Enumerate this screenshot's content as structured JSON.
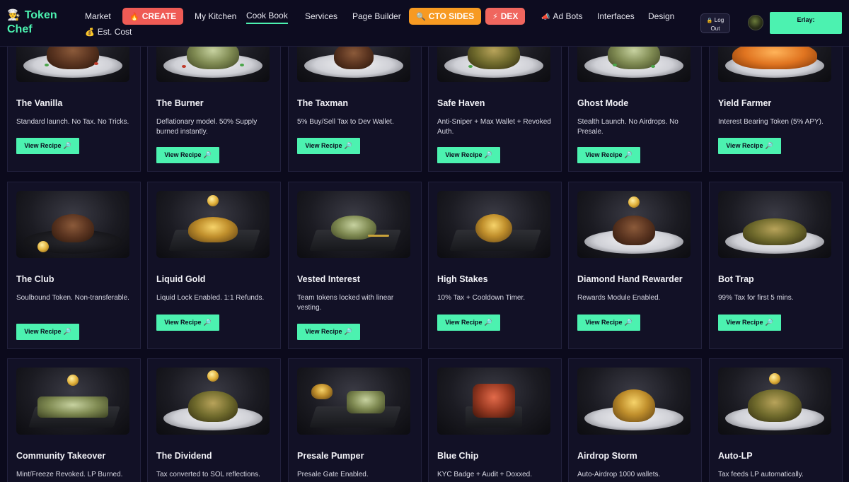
{
  "header": {
    "logo_line1": "Token",
    "logo_line2": "Chef",
    "logo_icon": "chef-icon",
    "est_cost": "Est. Cost",
    "nav": {
      "market": "Market",
      "create": "CREATE",
      "my_kitchen": "My Kitchen",
      "cook_book": "Cook Book",
      "services": "Services",
      "page_builder": "Page Builder",
      "cto_sides": "CTO SIDES",
      "dex": "DEX",
      "ad_bots": "Ad Bots",
      "interfaces": "Interfaces",
      "design": "Design"
    },
    "active_tab": "Cook Book",
    "logout_line1": "Log",
    "logout_line2": "Out",
    "user_label": "Erlay:",
    "colors": {
      "accent": "#4cf2b0",
      "create": "#ef5b55",
      "cto": "#f79a22",
      "dex": "#f0665e",
      "background": "#0b0a1c"
    }
  },
  "recipe_button_label": "View Recipe",
  "recipes": [
    {
      "title": "The Vanilla",
      "desc": "Standard launch. No Tax. No Tricks."
    },
    {
      "title": "The Burner",
      "desc": "Deflationary model. 50% Supply burned instantly."
    },
    {
      "title": "The Taxman",
      "desc": "5% Buy/Sell Tax to Dev Wallet."
    },
    {
      "title": "Safe Haven",
      "desc": "Anti-Sniper + Max Wallet + Revoked Auth."
    },
    {
      "title": "Ghost Mode",
      "desc": "Stealth Launch. No Airdrops. No Presale."
    },
    {
      "title": "Yield Farmer",
      "desc": "Interest Bearing Token (5% APY)."
    },
    {
      "title": "The Club",
      "desc": "Soulbound Token. Non-transferable."
    },
    {
      "title": "Liquid Gold",
      "desc": "Liquid Lock Enabled. 1:1 Refunds."
    },
    {
      "title": "Vested Interest",
      "desc": "Team tokens locked with linear vesting."
    },
    {
      "title": "High Stakes",
      "desc": "10% Tax + Cooldown Timer."
    },
    {
      "title": "Diamond Hand Rewarder",
      "desc": "Rewards Module Enabled."
    },
    {
      "title": "Bot Trap",
      "desc": "99% Tax for first 5 mins."
    },
    {
      "title": "Community Takeover",
      "desc": "Mint/Freeze Revoked. LP Burned."
    },
    {
      "title": "The Dividend",
      "desc": "Tax converted to SOL reflections."
    },
    {
      "title": "Presale Pumper",
      "desc": "Presale Gate Enabled."
    },
    {
      "title": "Blue Chip",
      "desc": "KYC Badge + Audit + Doxxed."
    },
    {
      "title": "Airdrop Storm",
      "desc": "Auto-Airdrop 1000 wallets."
    },
    {
      "title": "Auto-LP",
      "desc": "Tax feeds LP automatically."
    }
  ]
}
